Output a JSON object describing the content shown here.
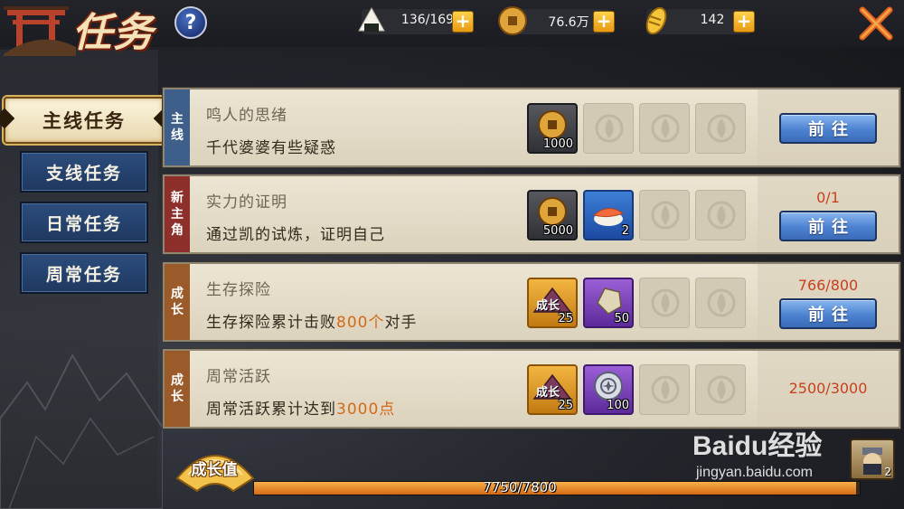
{
  "header": {
    "title": "任务",
    "help_label": "?",
    "resources": [
      {
        "name": "stamina",
        "icon": "rice-ball-icon",
        "value": "136/169",
        "plus": "+"
      },
      {
        "name": "coins",
        "icon": "coin-icon",
        "value": "76.6万",
        "plus": "+"
      },
      {
        "name": "gold",
        "icon": "gold-ingot-icon",
        "value": "142",
        "plus": "+"
      }
    ]
  },
  "tabs": [
    {
      "label": "主线任务",
      "active": true
    },
    {
      "label": "支线任务",
      "active": false
    },
    {
      "label": "日常任务",
      "active": false
    },
    {
      "label": "周常任务",
      "active": false
    }
  ],
  "quests": [
    {
      "tag_line1": "主",
      "tag_line2": "线",
      "title": "鸣人的思绪",
      "desc": "千代婆婆有些疑惑",
      "rewards": [
        {
          "icon": "coin-reward-icon",
          "count": "1000"
        }
      ],
      "progress": "",
      "button": "前往"
    },
    {
      "tag_line1": "新",
      "tag_line2": "主",
      "tag_line3": "角",
      "title": "实力的证明",
      "desc": "通过凯的试炼，证明自己",
      "rewards": [
        {
          "icon": "coin-reward-icon",
          "count": "5000"
        },
        {
          "icon": "sushi-reward-icon",
          "count": "2"
        }
      ],
      "progress": "0/1",
      "button": "前往"
    },
    {
      "tag_line1": "成",
      "tag_line2": "长",
      "title": "生存探险",
      "desc_prefix": "生存探险累计击败",
      "desc_highlight": "800个",
      "desc_suffix": "对手",
      "rewards": [
        {
          "icon": "growth-reward-icon",
          "label": "成长",
          "count": "25"
        },
        {
          "icon": "stone-reward-icon",
          "count": "50"
        }
      ],
      "progress": "766/800",
      "button": "前往"
    },
    {
      "tag_line1": "成",
      "tag_line2": "长",
      "title": "周常活跃",
      "desc_prefix": "周常活跃累计达到",
      "desc_highlight": "3000点",
      "desc_suffix": "",
      "rewards": [
        {
          "icon": "growth-reward-icon",
          "label": "成长",
          "count": "25"
        },
        {
          "icon": "silver-coin-reward-icon",
          "count": "100"
        }
      ],
      "progress": "2500/3000"
    }
  ],
  "growth": {
    "label": "成长值",
    "value": "7750/7800",
    "fraction": 0.9936
  },
  "avatar": {
    "count": "2"
  },
  "watermark": {
    "logo": "Baidu经验",
    "url": "jingyan.baidu.com"
  },
  "colors": {
    "progress_text": "#c8401e",
    "highlight": "#d4691a",
    "button_blue": "#4c82d0"
  }
}
